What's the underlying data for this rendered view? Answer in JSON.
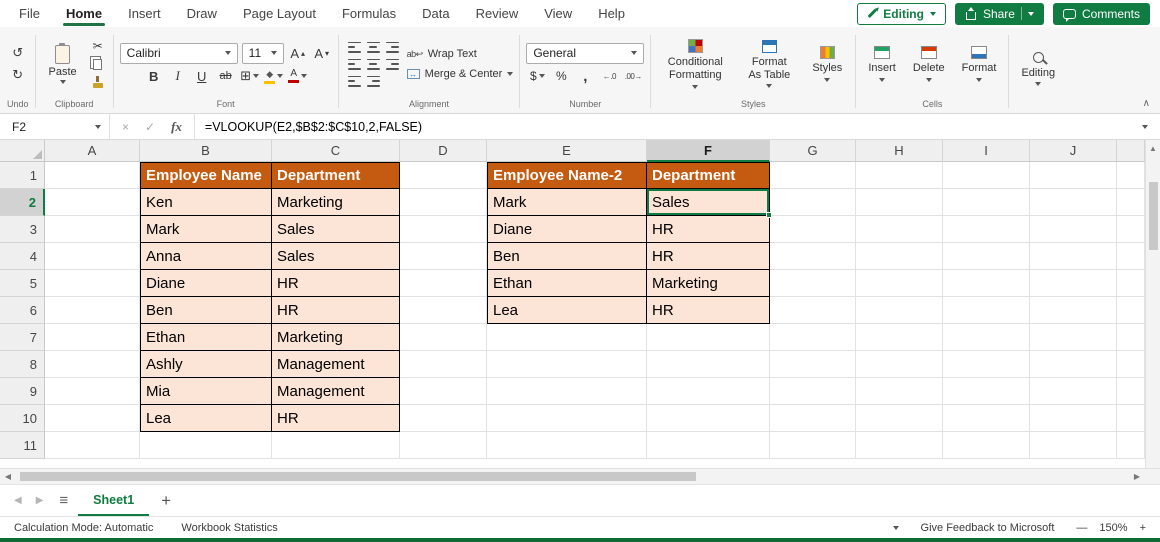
{
  "menubar": {
    "tabs": [
      {
        "label": "File",
        "active": false
      },
      {
        "label": "Home",
        "active": true
      },
      {
        "label": "Insert",
        "active": false
      },
      {
        "label": "Draw",
        "active": false
      },
      {
        "label": "Page Layout",
        "active": false
      },
      {
        "label": "Formulas",
        "active": false
      },
      {
        "label": "Data",
        "active": false
      },
      {
        "label": "Review",
        "active": false
      },
      {
        "label": "View",
        "active": false
      },
      {
        "label": "Help",
        "active": false
      }
    ],
    "editing_button": "Editing",
    "share_button": "Share",
    "comments_button": "Comments"
  },
  "ribbon": {
    "undo": {
      "label": "Undo"
    },
    "clipboard": {
      "paste": "Paste",
      "label": "Clipboard"
    },
    "font": {
      "family": "Calibri",
      "size": "11",
      "bold": "B",
      "italic": "I",
      "underline": "U",
      "strikethrough": "ab",
      "label": "Font"
    },
    "alignment": {
      "wrap_text": "Wrap Text",
      "merge_center": "Merge & Center",
      "label": "Alignment"
    },
    "number": {
      "format": "General",
      "currency": "$",
      "percent": "%",
      "comma": ",",
      "increase_decimal": "←.0",
      "decrease_decimal": ".00→",
      "label": "Number"
    },
    "styles": {
      "conditional": "Conditional Formatting",
      "format_table": "Format As Table",
      "cell_styles": "Styles",
      "label": "Styles"
    },
    "cells": {
      "insert": "Insert",
      "delete": "Delete",
      "format": "Format",
      "label": "Cells"
    },
    "editing_group": {
      "label": "Editing"
    }
  },
  "formula_bar": {
    "name_box": "F2",
    "fx_label": "fx",
    "formula": "=VLOOKUP(E2,$B$2:$C$10,2,FALSE)"
  },
  "grid": {
    "column_headers": [
      "A",
      "B",
      "C",
      "D",
      "E",
      "F",
      "G",
      "H",
      "I",
      "J"
    ],
    "row_count": 11,
    "selected_cell": "F2",
    "selected_column": "F",
    "selected_row": 2,
    "table1": {
      "origin_col": 1,
      "origin_row": 1,
      "headers": [
        "Employee Name",
        "Department"
      ],
      "rows": [
        [
          "Ken",
          "Marketing"
        ],
        [
          "Mark",
          "Sales"
        ],
        [
          "Anna",
          "Sales"
        ],
        [
          "Diane",
          "HR"
        ],
        [
          "Ben",
          "HR"
        ],
        [
          "Ethan",
          "Marketing"
        ],
        [
          "Ashly",
          "Management"
        ],
        [
          "Mia",
          "Management"
        ],
        [
          "Lea",
          "HR"
        ]
      ]
    },
    "table2": {
      "origin_col": 4,
      "origin_row": 1,
      "headers": [
        "Employee Name-2",
        "Department"
      ],
      "rows": [
        [
          "Mark",
          "Sales"
        ],
        [
          "Diane",
          "HR"
        ],
        [
          "Ben",
          "HR"
        ],
        [
          "Ethan",
          "Marketing"
        ],
        [
          "Lea",
          "HR"
        ]
      ]
    }
  },
  "sheet_bar": {
    "active_tab": "Sheet1",
    "add_label": "+"
  },
  "status_bar": {
    "calculation_mode": "Calculation Mode: Automatic",
    "workbook_statistics": "Workbook Statistics",
    "feedback": "Give Feedback to Microsoft",
    "zoom_out": "—",
    "zoom_level": "150%",
    "zoom_in": "+"
  },
  "colors": {
    "excel_green": "#107C41",
    "tab_underline_green": "#217346",
    "table_header_bg": "#C55A11",
    "table_cell_bg": "#FCE4D6"
  }
}
